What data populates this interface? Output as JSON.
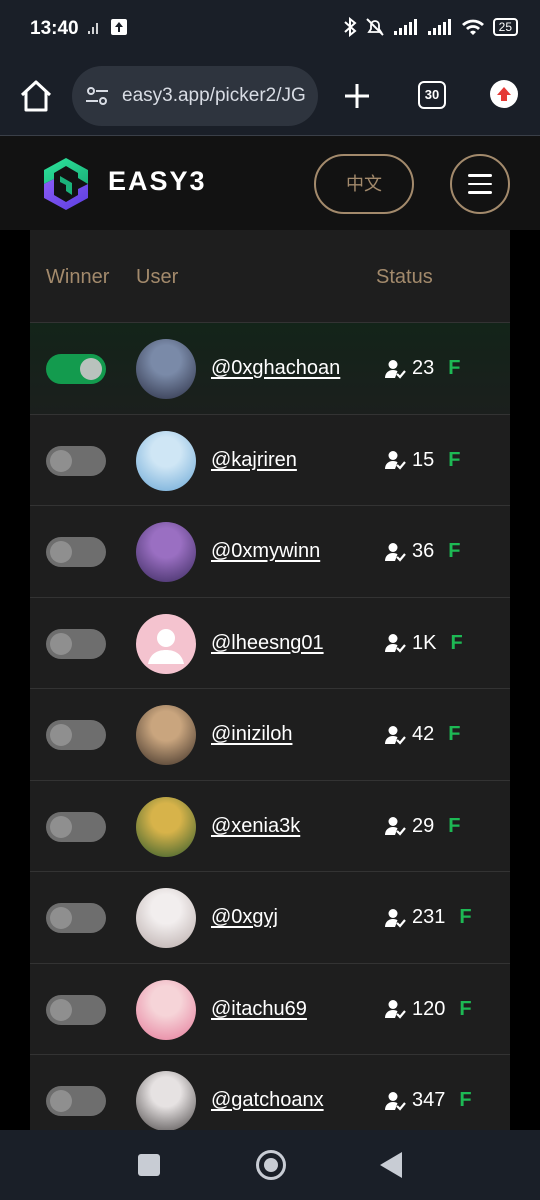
{
  "status_bar": {
    "time": "13:40",
    "battery": "25"
  },
  "browser": {
    "url": "easy3.app/picker2/JG",
    "tab_count": "30"
  },
  "header": {
    "brand": "EASY3",
    "lang_button": "中文"
  },
  "table": {
    "columns": {
      "winner": "Winner",
      "user": "User",
      "status": "Status"
    },
    "follow_label": "F",
    "rows": [
      {
        "username": "@0xghachoan",
        "count": "23",
        "winner": true,
        "avatar_colors": [
          "#7a8aa8",
          "#2b2f44"
        ]
      },
      {
        "username": "@kajriren",
        "count": "15",
        "winner": false,
        "avatar_colors": [
          "#cfe6f5",
          "#6aa7d6"
        ]
      },
      {
        "username": "@0xmywinn",
        "count": "36",
        "winner": false,
        "avatar_colors": [
          "#9a6fc2",
          "#3a2a5e"
        ]
      },
      {
        "username": "@lheesng01",
        "count": "1K",
        "winner": false,
        "avatar_colors": [
          "#f4c3cf",
          "#f4c3cf"
        ]
      },
      {
        "username": "@iniziloh",
        "count": "42",
        "winner": false,
        "avatar_colors": [
          "#c9a57e",
          "#3c2f26"
        ]
      },
      {
        "username": "@xenia3k",
        "count": "29",
        "winner": false,
        "avatar_colors": [
          "#d7b34a",
          "#2f5a2c"
        ]
      },
      {
        "username": "@0xgyj",
        "count": "231",
        "winner": false,
        "avatar_colors": [
          "#f2eeee",
          "#b7aaa8"
        ]
      },
      {
        "username": "@itachu69",
        "count": "120",
        "winner": false,
        "avatar_colors": [
          "#f6d4d8",
          "#e57a9a"
        ]
      },
      {
        "username": "@gatchoanx",
        "count": "347",
        "winner": false,
        "avatar_colors": [
          "#e6e2e2",
          "#4a4646"
        ]
      }
    ]
  },
  "colors": {
    "accent": "#a38a6c",
    "toggle_on": "#139b4e",
    "follow": "#1db954"
  }
}
